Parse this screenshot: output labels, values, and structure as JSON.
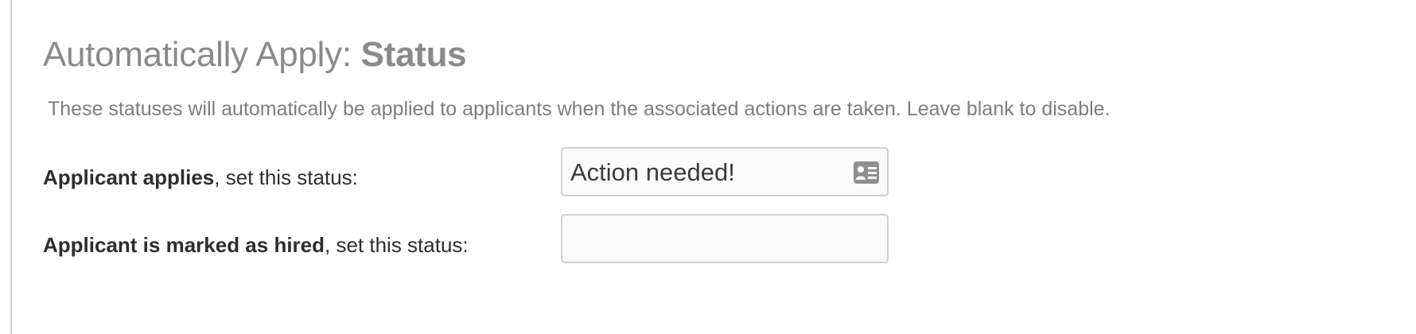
{
  "section": {
    "title_prefix": "Automatically Apply: ",
    "title_bold": "Status",
    "description": "These statuses will automatically be applied to applicants when the associated actions are taken. Leave blank to disable."
  },
  "rows": [
    {
      "label_bold": "Applicant applies",
      "label_rest": ", set this status:",
      "value": "Action needed!",
      "icon": "contact-card-icon"
    },
    {
      "label_bold": "Applicant is marked as hired",
      "label_rest": ", set this status:",
      "value": ""
    }
  ]
}
